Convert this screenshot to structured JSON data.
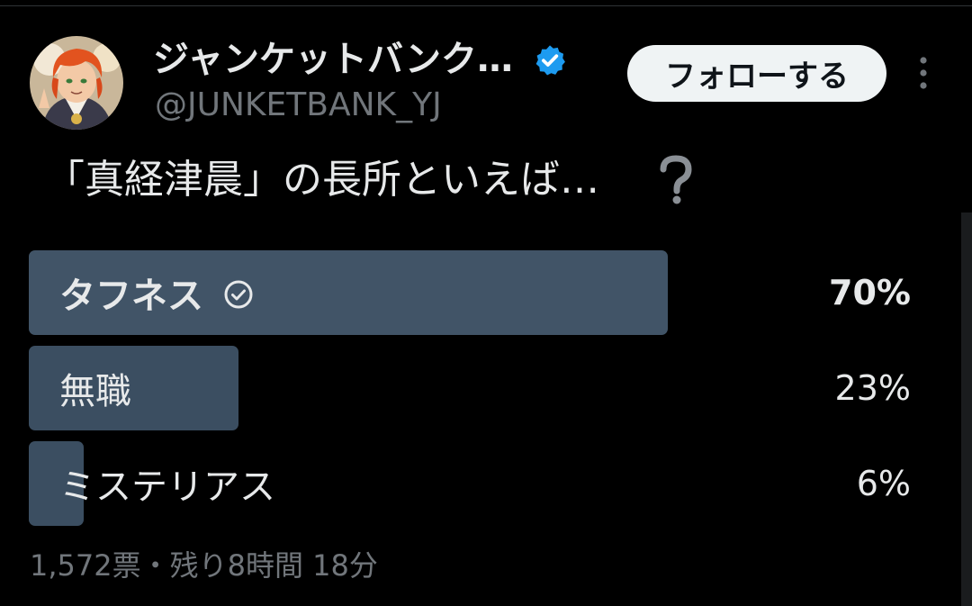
{
  "author": {
    "display_name": "ジャンケットバンク…",
    "handle": "@JUNKETBANK_YJ",
    "verified": true,
    "verified_icon": "verified-badge-icon",
    "avatar_icon": "profile-avatar"
  },
  "actions": {
    "follow_label": "フォローする",
    "more_icon": "more-vertical-icon"
  },
  "tweet": {
    "text": "「真経津晨」の長所といえば…",
    "question_icon": "question-mark-icon"
  },
  "poll": {
    "options": [
      {
        "label": "タフネス",
        "percent_label": "70%",
        "percent": 70,
        "winner": true,
        "check_icon": "check-circle-icon"
      },
      {
        "label": "無職",
        "percent_label": "23%",
        "percent": 23,
        "winner": false
      },
      {
        "label": "ミステリアス",
        "percent_label": "6%",
        "percent": 6,
        "winner": false
      }
    ],
    "meta": "1,572票・残り8時間 18分"
  },
  "colors": {
    "background": "#000000",
    "text_primary": "#e7e9ea",
    "text_secondary": "#71767b",
    "poll_bar": "#3b4e61",
    "poll_bar_winner": "#415467",
    "verified_blue": "#1d9bf0",
    "follow_button_bg": "#eff3f4"
  }
}
